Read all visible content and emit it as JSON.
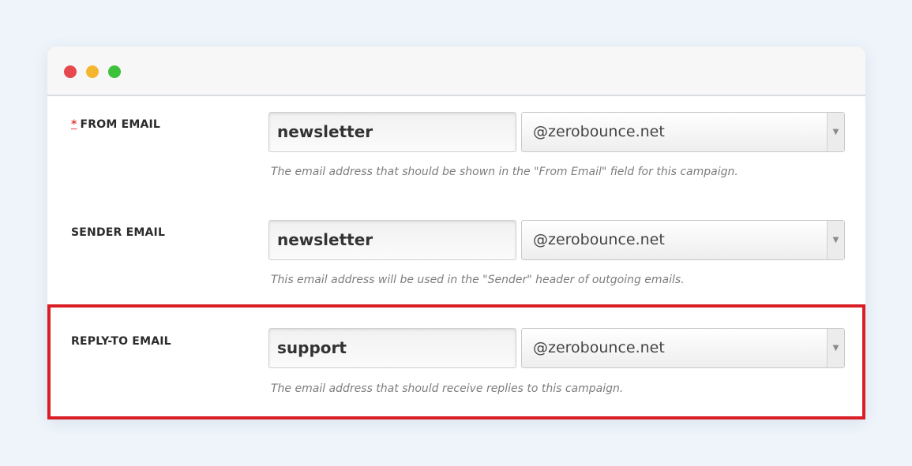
{
  "window": {
    "controls": [
      {
        "name": "close",
        "color": "#e5484d"
      },
      {
        "name": "minimize",
        "color": "#f5b52e"
      },
      {
        "name": "maximize",
        "color": "#3cc13b"
      }
    ]
  },
  "fields": {
    "from": {
      "required_mark": "*",
      "label": "FROM EMAIL",
      "local_value": "newsletter",
      "domain_value": "@zerobounce.net",
      "hint": "The email address that should be shown in the \"From Email\" field for this campaign."
    },
    "sender": {
      "label": "SENDER EMAIL",
      "local_value": "newsletter",
      "domain_value": "@zerobounce.net",
      "hint": "This email address will be used in the \"Sender\" header of outgoing emails."
    },
    "reply_to": {
      "label": "REPLY-TO EMAIL",
      "local_value": "support",
      "domain_value": "@zerobounce.net",
      "hint": "The email address that should receive replies to this campaign.",
      "highlighted": true,
      "highlight_color": "#d81f26"
    }
  },
  "icons": {
    "select_arrow": "chevron-down-icon"
  }
}
